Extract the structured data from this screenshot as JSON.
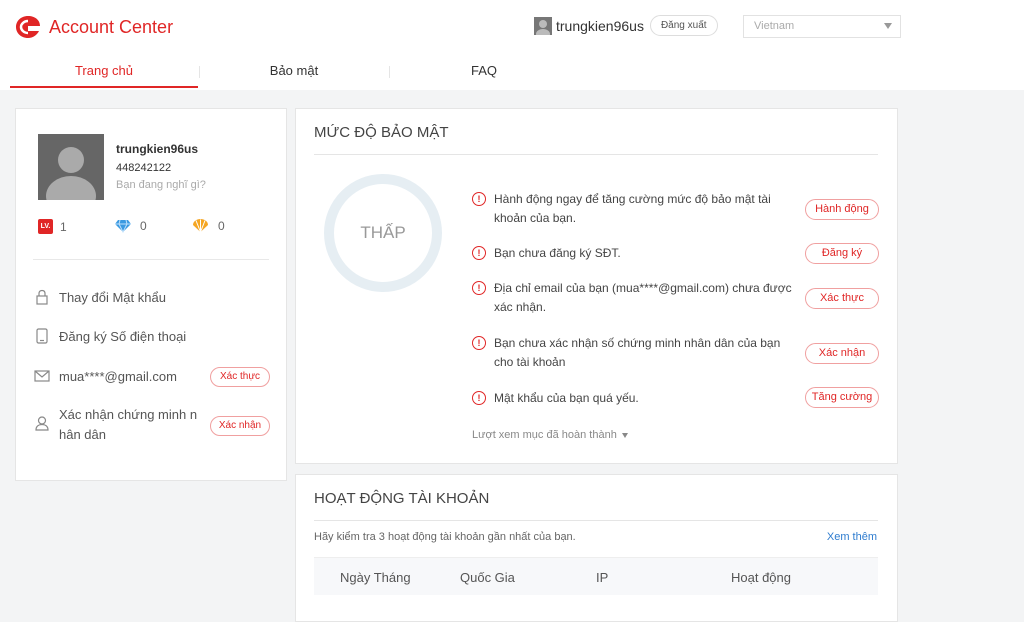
{
  "header": {
    "brand": "Account Center",
    "username": "trungkien96us",
    "logout_label": "Đăng xuất",
    "country": "Vietnam",
    "accent_color": "#e02626"
  },
  "nav": {
    "tabs": [
      {
        "label": "Trang chủ",
        "active": true
      },
      {
        "label": "Bảo mật",
        "active": false
      },
      {
        "label": "FAQ",
        "active": false
      }
    ]
  },
  "profile": {
    "name": "trungkien96us",
    "id": "448242122",
    "status_placeholder": "Bạn đang nghĩ gì?",
    "stats": [
      {
        "icon": "level-icon",
        "badge": "LV.",
        "value": "1"
      },
      {
        "icon": "diamond-icon",
        "value": "0"
      },
      {
        "icon": "shell-icon",
        "value": "0"
      }
    ],
    "menu": [
      {
        "icon": "lock-icon",
        "label": "Thay đổi Mật khẩu"
      },
      {
        "icon": "phone-icon",
        "label": "Đăng ký Số điện thoại"
      },
      {
        "icon": "mail-icon",
        "label": "mua****@gmail.com",
        "action": "Xác thực"
      },
      {
        "icon": "id-card-icon",
        "label": "Xác nhận chứng minh n hân dân",
        "action": "Xác nhận"
      }
    ]
  },
  "security": {
    "title": "MỨC ĐỘ BẢO MẬT",
    "level": "THẤP",
    "items": [
      {
        "text": "Hành động ngay để tăng cường mức độ bảo mật tài khoản của bạn.",
        "action": "Hành động"
      },
      {
        "text": "Bạn chưa đăng ký SĐT.",
        "action": "Đăng ký"
      },
      {
        "text": "Địa chỉ email của bạn (mua****@gmail.com) chưa được xác nhận.",
        "action": "Xác thực"
      },
      {
        "text": "Bạn chưa xác nhận số chứng minh nhân dân của bạn cho tài khoản",
        "action": "Xác nhận"
      },
      {
        "text": "Mật khẩu của bạn quá yếu.",
        "action": "Tăng cường"
      }
    ],
    "more_label": "Lượt xem mục đã hoàn thành"
  },
  "activity": {
    "title": "HOẠT ĐỘNG TÀI KHOẢN",
    "description": "Hãy kiểm tra 3 hoạt động tài khoản gần nhất của bạn.",
    "more_label": "Xem thêm",
    "columns": [
      "Ngày Tháng",
      "Quốc Gia",
      "IP",
      "Hoạt động"
    ]
  }
}
